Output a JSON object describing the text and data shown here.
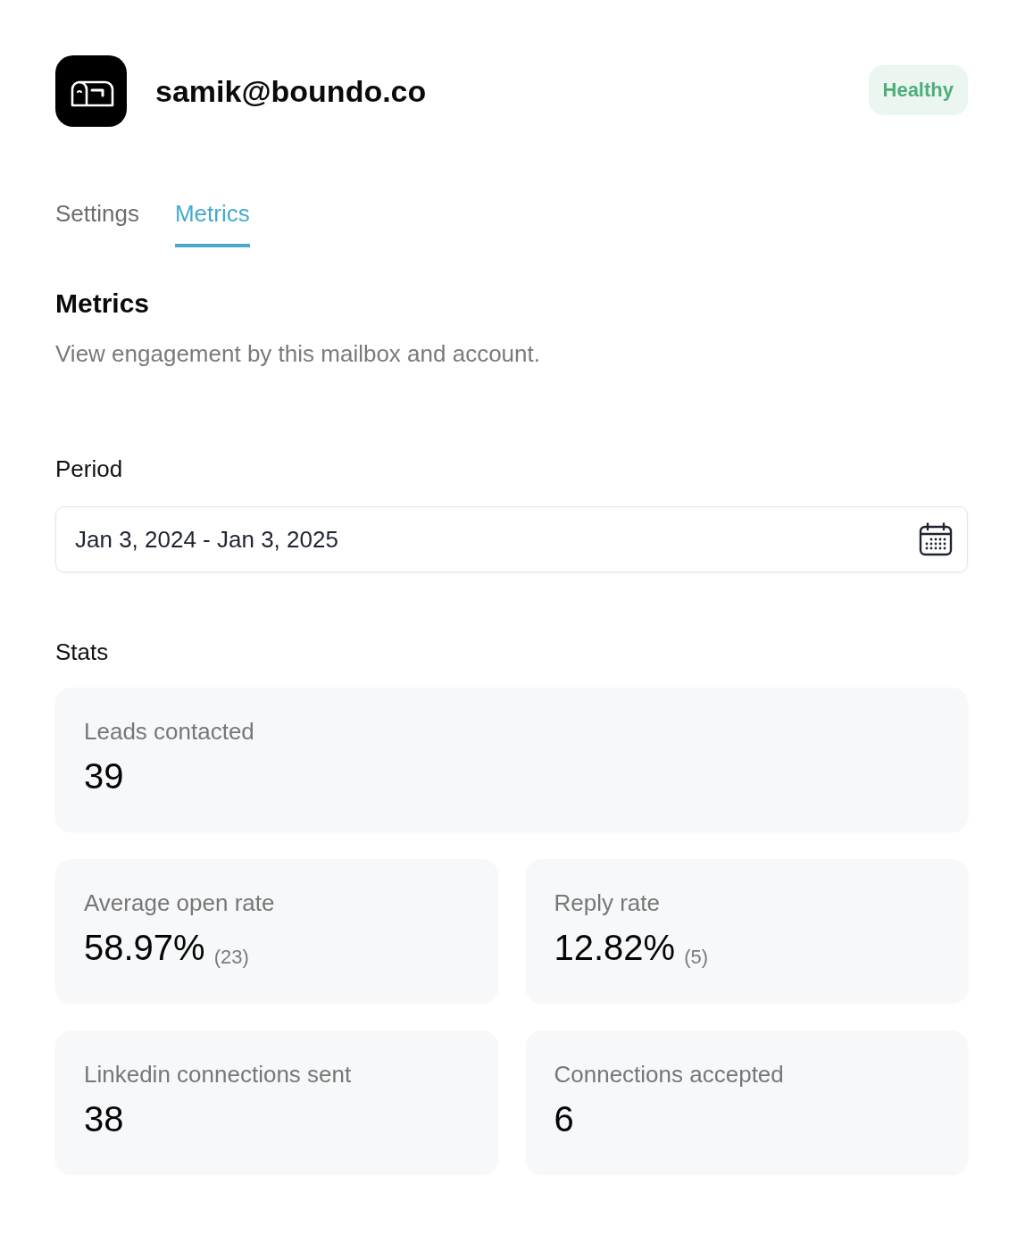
{
  "header": {
    "email": "samik@boundo.co",
    "status": {
      "label": "Healthy",
      "kind": "healthy"
    }
  },
  "tabs": [
    {
      "label": "Settings",
      "selected": false
    },
    {
      "label": "Metrics",
      "selected": true
    }
  ],
  "section": {
    "title": "Metrics",
    "description": "View engagement by this mailbox and account."
  },
  "period": {
    "label": "Period",
    "value": "Jan 3, 2024 - Jan 3, 2025"
  },
  "stats": {
    "title": "Stats",
    "rows": [
      {
        "cards": [
          {
            "label": "Leads contacted",
            "value": "39"
          }
        ]
      },
      {
        "cards": [
          {
            "label": "Average open rate",
            "value": "58.97%",
            "count": "(23)"
          },
          {
            "label": "Reply rate",
            "value": "12.82%",
            "count": "(5)"
          }
        ]
      },
      {
        "cards": [
          {
            "label": "Linkedin connections sent",
            "value": "38"
          },
          {
            "label": "Connections accepted",
            "value": "6"
          }
        ]
      }
    ]
  }
}
